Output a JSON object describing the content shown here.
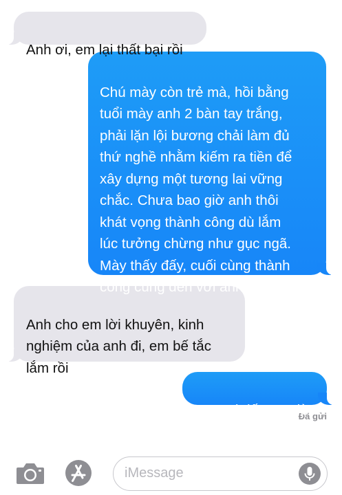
{
  "conversation": {
    "messages": [
      {
        "direction": "incoming",
        "text": "Anh ơi, em lại thất bại rồi"
      },
      {
        "direction": "outgoing",
        "text": "Chú mày còn trẻ mà, hồi bằng\ntuổi mày anh 2 bàn tay trắng,\nphải lặn lội bương chải làm đủ\nthứ nghề nhằm kiếm ra tiền để\nxây dựng một tương lai vững\nchắc. Chưa bao giờ anh thôi\nkhát vọng thành công dù lắm\nlúc tưởng chừng như gục ngã.\nMày thấy đấy, cuối cùng thành\ncông cũng đến với anh"
      },
      {
        "direction": "incoming",
        "text": "Anh cho em lời khuyên, kinh\nnghiệm của anh đi, em bế tắc\nlắm rồi"
      },
      {
        "direction": "outgoing",
        "text": "anh lấy vợ giàu"
      }
    ],
    "delivery_status": "Đã gửi"
  },
  "input_bar": {
    "placeholder": "iMessage",
    "icons": {
      "camera": "camera-icon",
      "apps": "app-store-icon",
      "mic": "microphone-icon"
    }
  },
  "colors": {
    "incoming_bubble": "#e6e5eb",
    "outgoing_bubble": "#1786f8",
    "icon_gray": "#8e8e93"
  }
}
